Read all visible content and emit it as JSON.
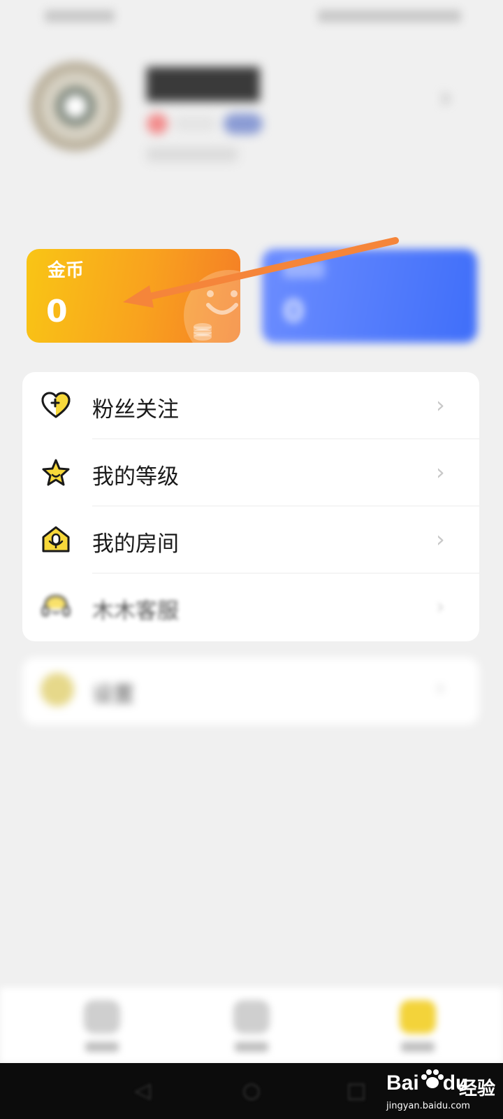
{
  "wallet": {
    "gold": {
      "title": "金币",
      "value": "0",
      "icon": "coin-stack-icon"
    },
    "blue": {
      "value": "0"
    }
  },
  "menu": {
    "items": [
      {
        "label": "粉丝关注",
        "icon": "heart-plus-icon"
      },
      {
        "label": "我的等级",
        "icon": "star-icon"
      },
      {
        "label": "我的房间",
        "icon": "home-mic-icon"
      },
      {
        "label": "木木客服",
        "icon": "headset-icon"
      }
    ],
    "chevron": "›"
  },
  "settings": {
    "label": "设置"
  },
  "watermark": {
    "brand_a": "Bai",
    "brand_b": "du",
    "brand_c": "经验",
    "url": "jingyan.baidu.com"
  },
  "colors": {
    "gold_start": "#f9c515",
    "gold_end": "#f47d26",
    "blue": "#3f6ef9",
    "annotation_arrow": "#f5853a",
    "icon_yellow": "#f7d83a"
  }
}
